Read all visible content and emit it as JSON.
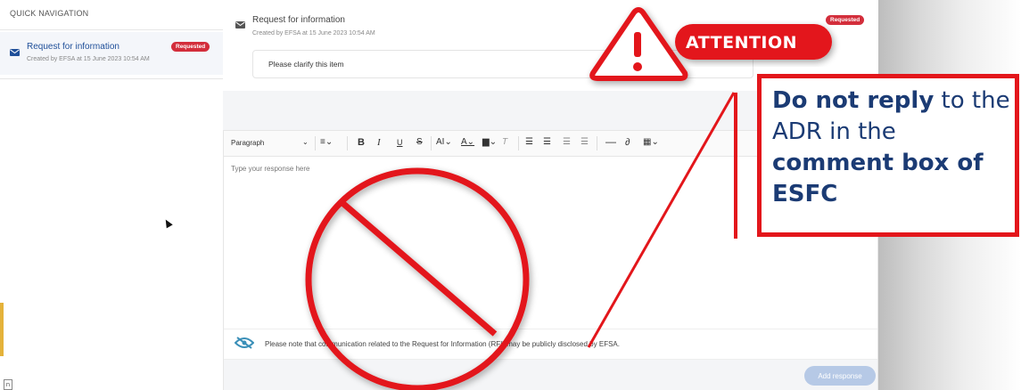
{
  "sidebar": {
    "title": "QUICK NAVIGATION",
    "items": [
      {
        "title": "Request for information",
        "badge": "Requested",
        "subtitle": "Created by EFSA at 15 June 2023 10:54 AM"
      }
    ]
  },
  "request": {
    "title": "Request for information",
    "subtitle": "Created by EFSA at 15 June 2023 10:54 AM",
    "badge": "Requested",
    "comment": "Please clarify this item"
  },
  "editor": {
    "style_select": "Paragraph",
    "toolbar_icons": [
      "align-icon",
      "bold-icon",
      "italic-icon",
      "underline-icon",
      "strikethrough-icon",
      "font-size-icon",
      "font-color-icon",
      "highlight-icon",
      "clear-format-icon",
      "bullet-list-icon",
      "numbered-list-icon",
      "indent-icon",
      "outdent-icon",
      "horizontal-line-icon",
      "link-icon",
      "table-icon"
    ],
    "placeholder": "Type your response here",
    "notice": "Please note that communication related to the Request for Information (RFI) may be publicly disclosed by EFSA.",
    "add_button": "Add response"
  },
  "overlay": {
    "attention": "ATTENTION",
    "callout_strong1": "Do not reply",
    "callout_text1": " to the ADR in the ",
    "callout_strong2": "comment box of ESFC"
  },
  "colors": {
    "accent_red": "#e3161b",
    "badge_red": "#d32e3b",
    "link_blue": "#1f4f99",
    "callout_text": "#1b3b74"
  }
}
